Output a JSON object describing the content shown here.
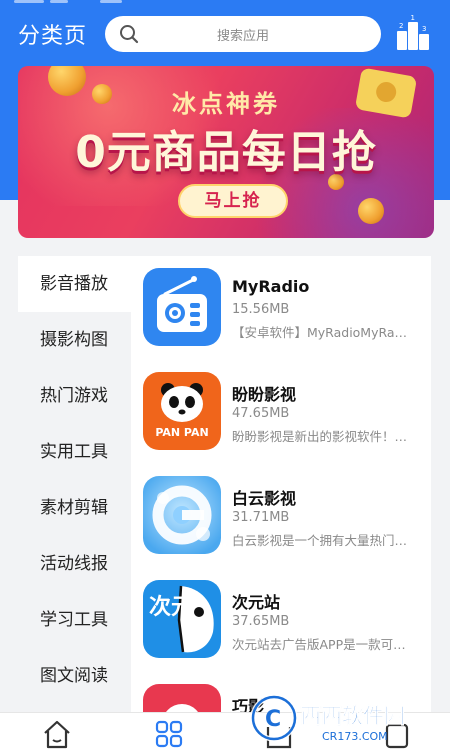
{
  "header": {
    "title": "分类页",
    "search_placeholder": "搜索应用",
    "icons": {
      "search": "search-icon",
      "rank": "ranking-icon"
    },
    "rank_digits": [
      "2",
      "1",
      "3"
    ]
  },
  "banner": {
    "subtitle": "冰点神券",
    "headline": "0元商品每日抢",
    "button_label": "马上抢"
  },
  "categories": [
    {
      "label": "影音播放",
      "active": true
    },
    {
      "label": "摄影构图",
      "active": false
    },
    {
      "label": "热门游戏",
      "active": false
    },
    {
      "label": "实用工具",
      "active": false
    },
    {
      "label": "素材剪辑",
      "active": false
    },
    {
      "label": "活动线报",
      "active": false
    },
    {
      "label": "学习工具",
      "active": false
    },
    {
      "label": "图文阅读",
      "active": false
    }
  ],
  "apps": [
    {
      "name": "MyRadio",
      "size": "15.56MB",
      "desc": "【安卓软件】MyRadioMyRa…",
      "icon": "radio-app-icon"
    },
    {
      "name": "盼盼影视",
      "size": "47.65MB",
      "desc": "盼盼影视是新出的影视软件！…",
      "icon": "panda-app-icon",
      "icon_text": "PAN PAN"
    },
    {
      "name": "白云影视",
      "size": "31.71MB",
      "desc": "白云影视是一个拥有大量热门…",
      "icon": "cloud-app-icon"
    },
    {
      "name": "次元站",
      "size": "37.65MB",
      "desc": "次元站去广告版APP是一款可…",
      "icon": "ciyuan-app-icon",
      "icon_text": "次元"
    },
    {
      "name": "巧影",
      "size": "",
      "desc": "",
      "icon": "kinemaster-app-icon"
    }
  ],
  "bottom_nav": [
    {
      "name": "home",
      "icon": "home-icon",
      "active": false
    },
    {
      "name": "category",
      "icon": "category-grid-icon",
      "active": true
    },
    {
      "name": "rank",
      "icon": "rank-icon",
      "active": false
    },
    {
      "name": "mine",
      "icon": "mine-icon",
      "active": false
    }
  ],
  "watermark": {
    "brand": "西西软件园",
    "domain": "CR173.COM"
  },
  "colors": {
    "primary": "#2b7bf3",
    "banner": "#e4325f",
    "text": "#222222",
    "muted": "#8a8a8a"
  }
}
